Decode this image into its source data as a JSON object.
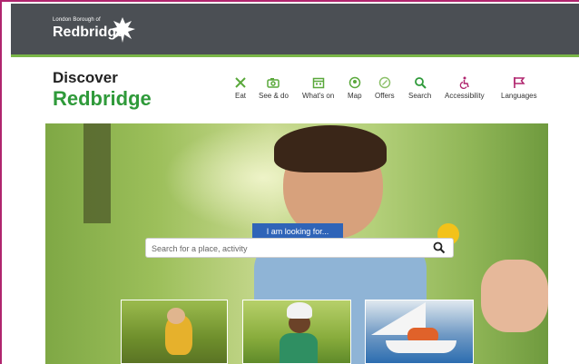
{
  "header": {
    "council_small": "London Borough of",
    "council_name": "Redbridge"
  },
  "brand": {
    "line1": "Discover",
    "line2": "Redbridge"
  },
  "nav": [
    {
      "label": "Eat",
      "icon": "cutlery-icon"
    },
    {
      "label": "See & do",
      "icon": "camera-icon"
    },
    {
      "label": "What's on",
      "icon": "calendar-icon"
    },
    {
      "label": "Map",
      "icon": "map-pin-icon"
    },
    {
      "label": "Offers",
      "icon": "offer-tag-icon"
    },
    {
      "label": "Search",
      "icon": "search-icon"
    },
    {
      "label": "Accessibility",
      "icon": "wheelchair-icon"
    },
    {
      "label": "Languages",
      "icon": "flag-icon"
    }
  ],
  "search": {
    "label": "I am looking for...",
    "placeholder": "Search for a place, activity"
  },
  "colors": {
    "brand_green": "#2f9a3a",
    "nav_icon_green": "#5aa83b",
    "search_blue": "#2f64b8",
    "accent_magenta": "#b0256e",
    "header_grey": "#4b4f54"
  }
}
